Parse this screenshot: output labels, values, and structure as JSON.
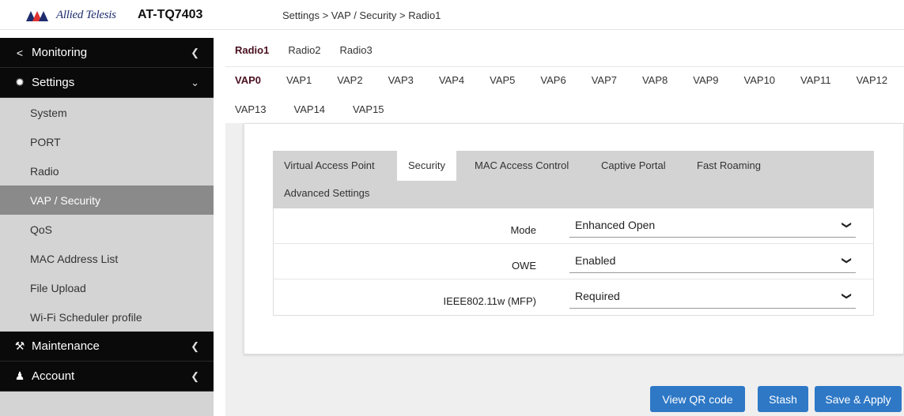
{
  "header": {
    "brand": "Allied Telesis",
    "model": "AT-TQ7403",
    "breadcrumb": "Settings > VAP / Security > Radio1"
  },
  "sidebar": {
    "monitoring": {
      "label": "Monitoring",
      "icon": "share-icon"
    },
    "settings": {
      "label": "Settings",
      "icon": "gear-icon"
    },
    "settings_items": [
      {
        "label": "System"
      },
      {
        "label": "PORT"
      },
      {
        "label": "Radio"
      },
      {
        "label": "VAP / Security",
        "active": true
      },
      {
        "label": "QoS"
      },
      {
        "label": "MAC Address List"
      },
      {
        "label": "File Upload"
      },
      {
        "label": "Wi-Fi Scheduler profile"
      }
    ],
    "maintenance": {
      "label": "Maintenance",
      "icon": "wrench-icon"
    },
    "account": {
      "label": "Account",
      "icon": "user-icon"
    }
  },
  "radio_tabs": [
    "Radio1",
    "Radio2",
    "Radio3"
  ],
  "vap_tabs_row1": [
    "VAP0",
    "VAP1",
    "VAP2",
    "VAP3",
    "VAP4",
    "VAP5",
    "VAP6",
    "VAP7",
    "VAP8",
    "VAP9",
    "VAP10",
    "VAP11",
    "VAP12"
  ],
  "vap_tabs_row2": [
    "VAP13",
    "VAP14",
    "VAP15"
  ],
  "security_tabs": [
    "Virtual Access Point",
    "Security",
    "MAC Access Control",
    "Captive Portal",
    "Fast Roaming",
    "Advanced Settings"
  ],
  "form": {
    "mode": {
      "label": "Mode",
      "value": "Enhanced Open"
    },
    "owe": {
      "label": "OWE",
      "value": "Enabled"
    },
    "mfp": {
      "label": "IEEE802.11w (MFP)",
      "value": "Required"
    }
  },
  "buttons": {
    "qr": "View QR code",
    "stash": "Stash",
    "apply": "Save & Apply"
  },
  "colors": {
    "accent": "#2e78c6",
    "active_tab_text": "#4a1020",
    "sidebar_dark": "#0a0a0a"
  }
}
